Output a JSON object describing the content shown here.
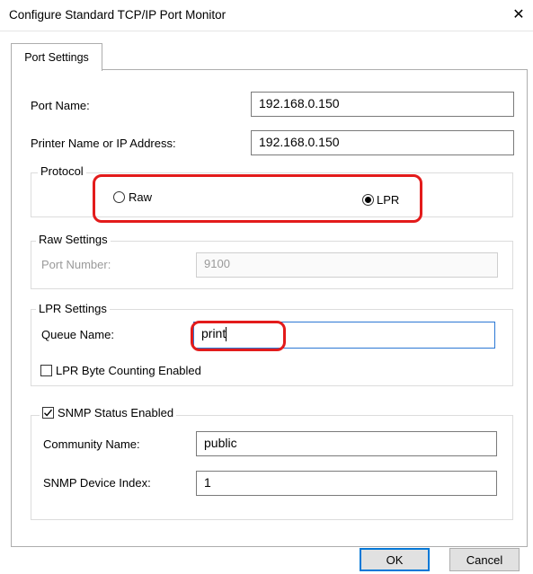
{
  "window": {
    "title": "Configure Standard TCP/IP Port Monitor",
    "close_glyph": "✕"
  },
  "tabs": [
    {
      "label": "Port Settings",
      "selected": true
    }
  ],
  "port_name": {
    "label": "Port Name:",
    "value": "192.168.0.150"
  },
  "printer_address": {
    "label": "Printer Name or IP Address:",
    "value": "192.168.0.150"
  },
  "protocol": {
    "legend": "Protocol",
    "options": [
      {
        "label": "Raw",
        "selected": false
      },
      {
        "label": "LPR",
        "selected": true
      }
    ]
  },
  "raw_settings": {
    "legend": "Raw Settings",
    "port_number_label": "Port Number:",
    "port_number_value": "9100",
    "enabled": false
  },
  "lpr_settings": {
    "legend": "LPR Settings",
    "queue_name_label": "Queue Name:",
    "queue_name_value": "print",
    "byte_counting_label": "LPR Byte Counting Enabled",
    "byte_counting_checked": false
  },
  "snmp": {
    "status_label": "SNMP Status Enabled",
    "status_checked": true,
    "community_label": "Community Name:",
    "community_value": "public",
    "device_index_label": "SNMP Device Index:",
    "device_index_value": "1"
  },
  "buttons": {
    "ok": "OK",
    "cancel": "Cancel"
  },
  "colors": {
    "highlight": "#e31b1b",
    "focus_border": "#2b78d4",
    "default_button_border": "#0078d7"
  }
}
